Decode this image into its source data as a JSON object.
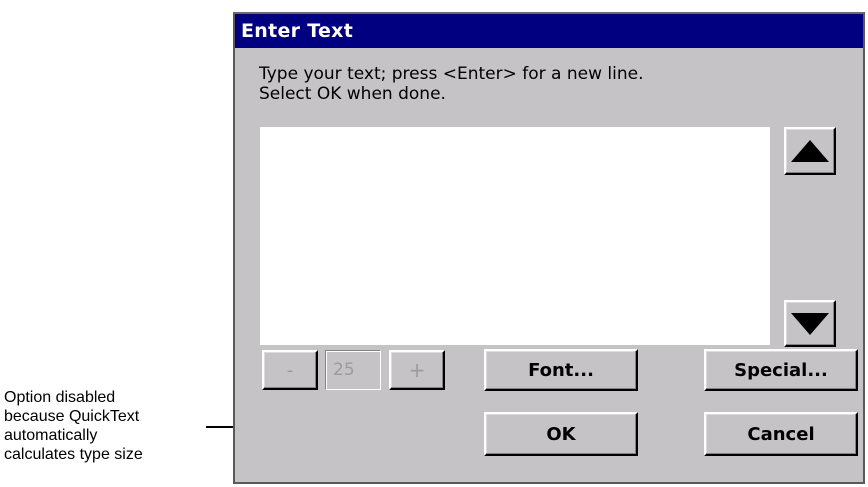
{
  "dialog": {
    "title": "Enter Text",
    "instruction_line1": "Type your text; press <Enter> for a new line.",
    "instruction_line2": "Select OK when done.",
    "text_value": "",
    "size_minus_label": "-",
    "size_value": "25",
    "size_plus_label": "+",
    "font_label": "Font...",
    "special_label": "Special...",
    "ok_label": "OK",
    "cancel_label": "Cancel"
  },
  "callout": {
    "line1": "Option disabled",
    "line2": "because QuickText",
    "line3": "automatically",
    "line4": "calculates type size"
  },
  "colors": {
    "titlebar": "#000080",
    "dialog_bg": "#c6c3c6",
    "disabled_text": "#9c9a9c"
  },
  "icons": {
    "scroll_up": "triangle-up-icon",
    "scroll_down": "triangle-down-icon"
  }
}
